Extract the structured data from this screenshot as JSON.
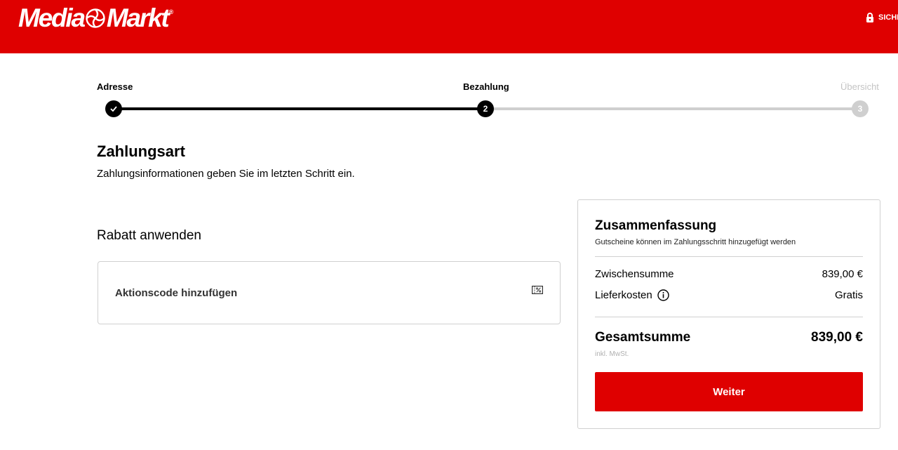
{
  "brand": {
    "logo_left": "Media",
    "logo_right": "Markt",
    "logo_mark": "®",
    "secure_label": "SICHER",
    "header_color": "#df0000"
  },
  "icons": {
    "lock": "lock-icon",
    "check": "checkmark-icon",
    "promo": "voucher-percent-icon",
    "info": "info-icon"
  },
  "stepper": {
    "steps": [
      {
        "label": "Adresse",
        "state": "completed",
        "marker": ""
      },
      {
        "label": "Bezahlung",
        "state": "current",
        "marker": "2"
      },
      {
        "label": "Übersicht",
        "state": "upcoming",
        "marker": "3"
      }
    ]
  },
  "page": {
    "title": "Zahlungsart",
    "subtitle": "Zahlungsinformationen geben Sie im letzten Schritt ein."
  },
  "discount": {
    "section_title": "Rabatt anwenden",
    "add_code_label": "Aktionscode hinzufügen"
  },
  "summary": {
    "title": "Zusammenfassung",
    "note": "Gutscheine können im Zahlungsschritt hinzugefügt werden",
    "subtotal_label": "Zwischensumme",
    "subtotal_value": "839,00 €",
    "shipping_label": "Lieferkosten",
    "shipping_value": "Gratis",
    "total_label": "Gesamtsumme",
    "total_value": "839,00 €",
    "tax_note": "inkl. MwSt.",
    "continue_label": "Weiter"
  }
}
